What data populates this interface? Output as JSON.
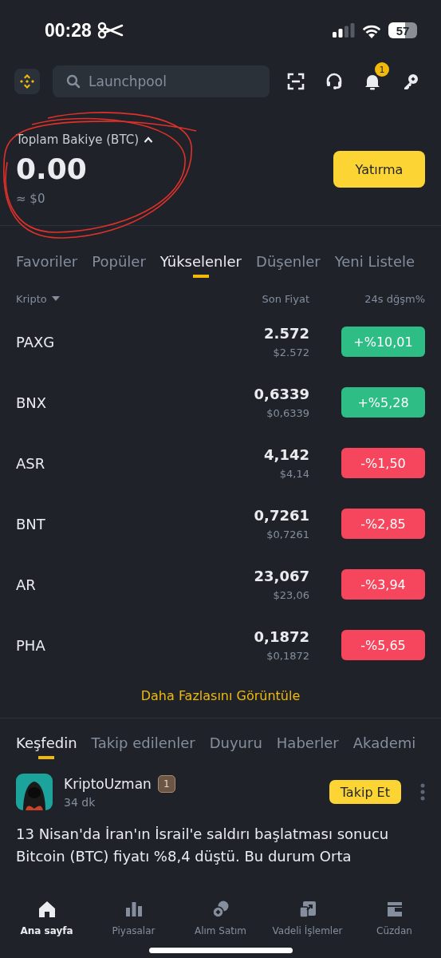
{
  "status_bar": {
    "time": "00:28",
    "battery": "57"
  },
  "header": {
    "search": {
      "placeholder": "Launchpool"
    },
    "notification_badge": "1"
  },
  "balance": {
    "label": "Toplam Bakiye (BTC)",
    "expanded": true,
    "amount": "0.00",
    "approx": "≈ $0",
    "deposit_button": "Yatırma"
  },
  "market_tabs": [
    {
      "label": "Favoriler",
      "selected": false
    },
    {
      "label": "Popüler",
      "selected": false
    },
    {
      "label": "Yükselenler",
      "selected": true
    },
    {
      "label": "Düşenler",
      "selected": false
    },
    {
      "label": "Yeni Listele",
      "selected": false
    }
  ],
  "market_table": {
    "columns": [
      "Kripto",
      "Son Fiyat",
      "24s dğşm%"
    ],
    "rows": [
      {
        "symbol": "PAXG",
        "price": "2.572",
        "price_usd": "$2.572",
        "change": "+%10,01",
        "color": "#2ebd85"
      },
      {
        "symbol": "BNX",
        "price": "0,6339",
        "price_usd": "$0,6339",
        "change": "+%5,28",
        "color": "#2ebd85"
      },
      {
        "symbol": "ASR",
        "price": "4,142",
        "price_usd": "$4,14",
        "change": "-%1,50",
        "color": "#f6465d"
      },
      {
        "symbol": "BNT",
        "price": "0,7261",
        "price_usd": "$0,7261",
        "change": "-%2,85",
        "color": "#f6465d"
      },
      {
        "symbol": "AR",
        "price": "23,067",
        "price_usd": "$23,06",
        "change": "-%3,94",
        "color": "#f6465d"
      },
      {
        "symbol": "PHA",
        "price": "0,1872",
        "price_usd": "$0,1872",
        "change": "-%5,65",
        "color": "#f6465d"
      }
    ]
  },
  "more_link": "Daha Fazlasını Görüntüle",
  "feed_tabs": [
    {
      "label": "Keşfedin",
      "selected": true
    },
    {
      "label": "Takip edilenler",
      "selected": false
    },
    {
      "label": "Duyuru",
      "selected": false
    },
    {
      "label": "Haberler",
      "selected": false
    },
    {
      "label": "Akademi",
      "selected": false
    }
  ],
  "post": {
    "author": "KriptoUzman",
    "rank": "1",
    "time": "34 dk",
    "follow_button": "Takip Et",
    "text": "13 Nisan'da İran'ın İsrail'e saldırı başlatması sonucu Bitcoin (BTC) fiyatı %8,4 düştü. Bu durum Orta"
  },
  "bottom_nav": [
    {
      "label": "Ana sayfa",
      "selected": true
    },
    {
      "label": "Piyasalar",
      "selected": false
    },
    {
      "label": "Alım Satım",
      "selected": false
    },
    {
      "label": "Vadeli İşlemler",
      "selected": false
    },
    {
      "label": "Cüzdan",
      "selected": false
    }
  ]
}
